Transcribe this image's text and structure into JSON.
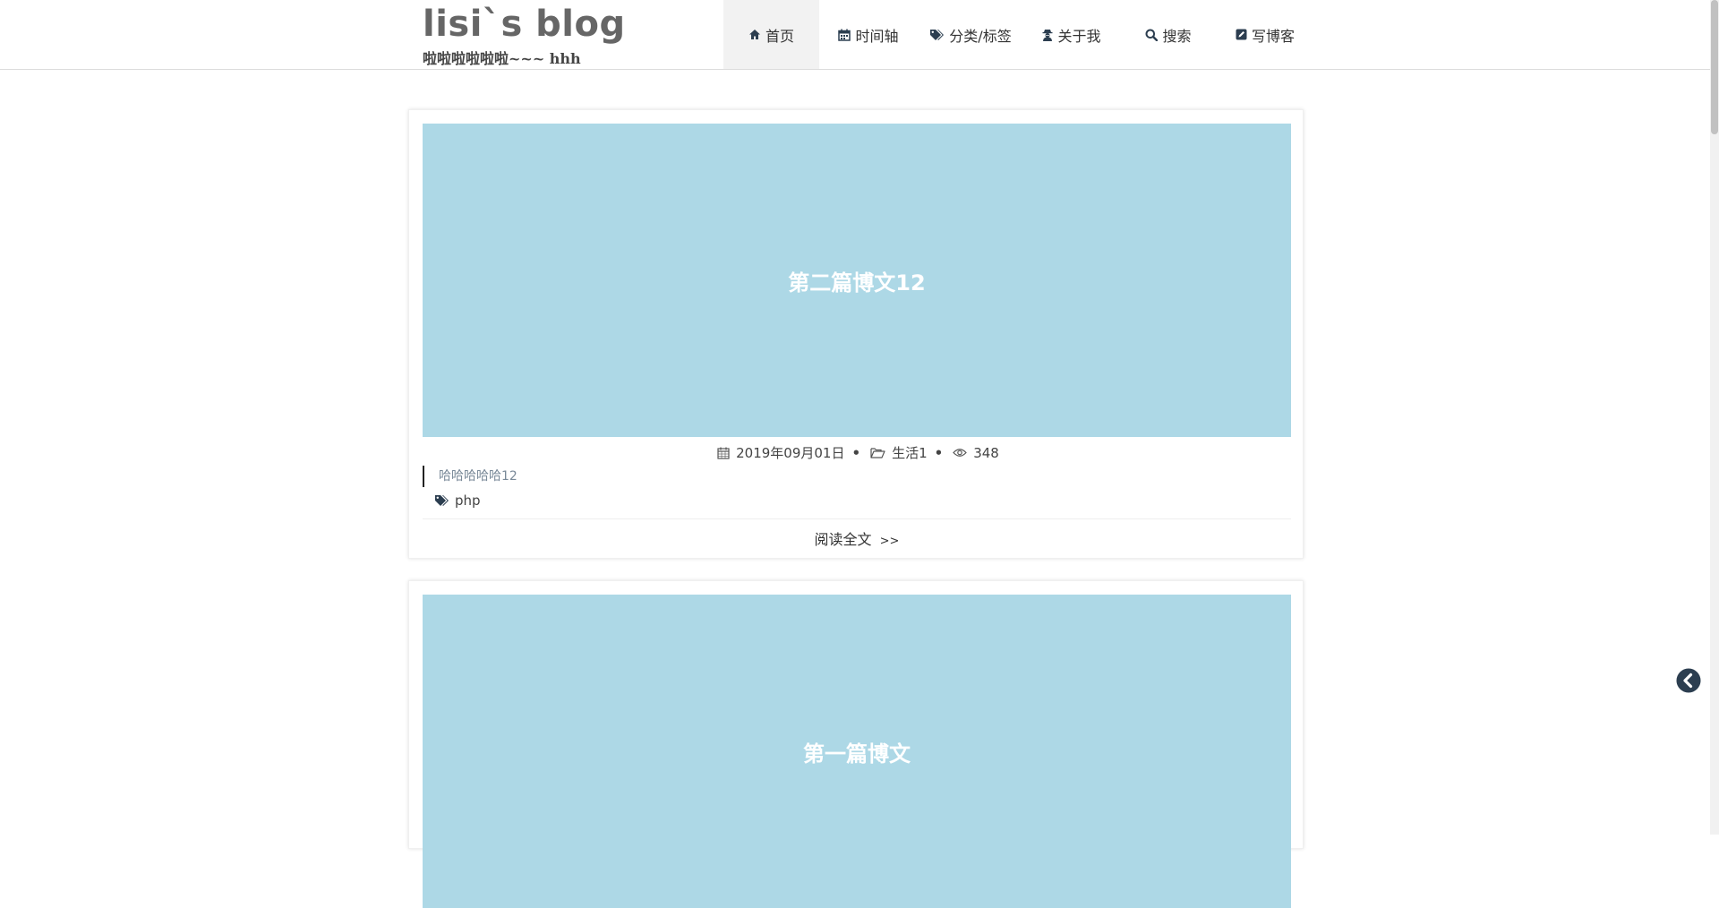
{
  "site": {
    "title": "lisi`s blog",
    "subtitle": "啦啦啦啦啦啦~~~ hhh"
  },
  "nav": {
    "items": [
      {
        "label": "首页",
        "icon": "home-icon",
        "active": true
      },
      {
        "label": "时间轴",
        "icon": "calendar-icon",
        "active": false
      },
      {
        "label": "分类/标签",
        "icon": "tags-icon",
        "active": false
      },
      {
        "label": "关于我",
        "icon": "user-secret-icon",
        "active": false
      },
      {
        "label": "搜索",
        "icon": "search-icon",
        "active": false
      },
      {
        "label": "写博客",
        "icon": "edit-icon",
        "active": false
      }
    ]
  },
  "posts": [
    {
      "title": "第二篇博文12",
      "date": "2019年09月01日",
      "category": "生活1",
      "views": "348",
      "excerpt": "哈哈哈哈哈12",
      "tag": "php",
      "read_more": "阅读全文",
      "read_more_arrow": ">>"
    },
    {
      "title": "第一篇博文"
    }
  ],
  "colors": {
    "banner": "#add8e6",
    "nav_active_bg": "#f2f2f2",
    "back_button": "#2c3e50"
  }
}
